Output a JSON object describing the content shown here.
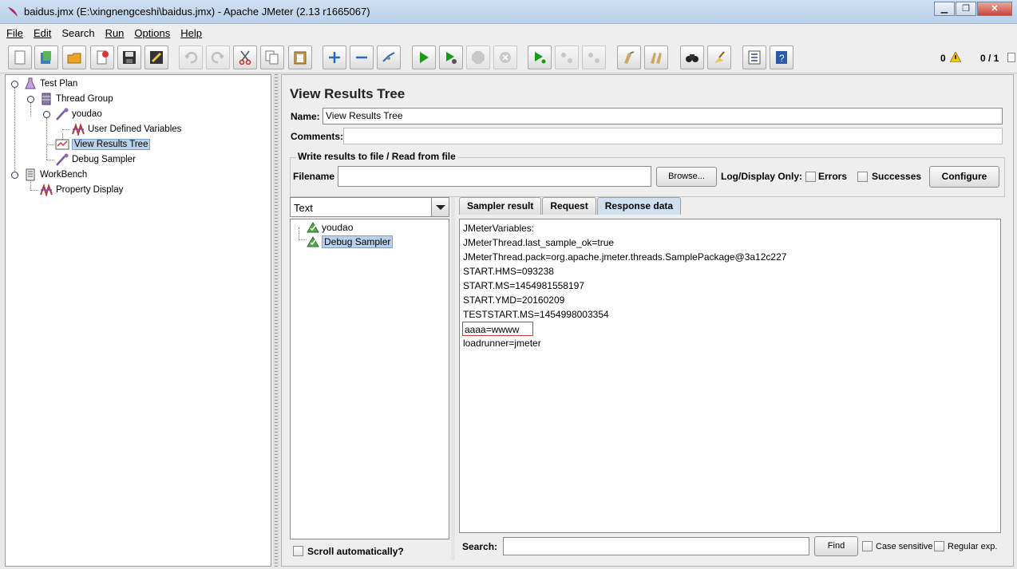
{
  "window": {
    "title": "baidus.jmx (E:\\xingnengceshi\\baidus.jmx) - Apache JMeter (2.13 r1665067)",
    "buttons": [
      "minimize",
      "restore",
      "close"
    ]
  },
  "menu": [
    "File",
    "Edit",
    "Search",
    "Run",
    "Options",
    "Help"
  ],
  "toolbar": {
    "buttons": [
      {
        "name": "new-icon"
      },
      {
        "name": "templates-icon"
      },
      {
        "name": "open-icon"
      },
      {
        "name": "close-file-icon"
      },
      {
        "name": "save-icon"
      },
      {
        "name": "save-screenshot-icon"
      },
      {
        "name": "undo-icon"
      },
      {
        "name": "redo-icon"
      },
      {
        "name": "cut-icon"
      },
      {
        "name": "copy-icon"
      },
      {
        "name": "paste-icon"
      },
      {
        "name": "expand-icon"
      },
      {
        "name": "collapse-icon"
      },
      {
        "name": "toggle-icon"
      },
      {
        "name": "start-icon"
      },
      {
        "name": "start-no-pauses-icon"
      },
      {
        "name": "stop-icon"
      },
      {
        "name": "shutdown-icon"
      },
      {
        "name": "remote-start-icon"
      },
      {
        "name": "remote-stop-icon"
      },
      {
        "name": "remote-shutdown-icon"
      },
      {
        "name": "clear-icon"
      },
      {
        "name": "clear-all-icon"
      },
      {
        "name": "search-icon"
      },
      {
        "name": "reset-search-icon"
      },
      {
        "name": "function-helper-icon"
      },
      {
        "name": "help-icon"
      }
    ],
    "warn_count": "0",
    "threads": "0 / 1"
  },
  "tree": [
    {
      "label": "Test Plan",
      "icon": "test-plan-icon"
    },
    {
      "label": "Thread Group",
      "icon": "thread-group-icon"
    },
    {
      "label": "youdao",
      "icon": "sampler-icon"
    },
    {
      "label": "User Defined Variables",
      "icon": "config-element-icon"
    },
    {
      "label": "View Results Tree",
      "icon": "listener-icon"
    },
    {
      "label": "Debug Sampler",
      "icon": "sampler-icon"
    },
    {
      "label": "WorkBench",
      "icon": "workbench-icon"
    },
    {
      "label": "Property Display",
      "icon": "config-element-icon"
    }
  ],
  "panel": {
    "title": "View Results Tree",
    "name_label": "Name:",
    "name_value": "View Results Tree",
    "comments_label": "Comments:",
    "file_group_title": "Write results to file / Read from file",
    "filename_label": "Filename",
    "filename_value": "",
    "browse_label": "Browse...",
    "log_display_label": "Log/Display Only:",
    "errors_label": "Errors",
    "successes_label": "Successes",
    "configure_label": "Configure"
  },
  "results": {
    "renderer": "Text",
    "items": [
      "youdao",
      "Debug Sampler"
    ],
    "scroll_auto_label": "Scroll automatically?",
    "tabs": [
      "Sampler result",
      "Request",
      "Response data"
    ],
    "active_tab": "Response data",
    "response_lines": [
      "JMeterVariables:",
      "JMeterThread.last_sample_ok=true",
      "JMeterThread.pack=org.apache.jmeter.threads.SamplePackage@3a12c227",
      "START.HMS=093238",
      "START.MS=1454981558197",
      "START.YMD=20160209",
      "TESTSTART.MS=1454998003354",
      "aaaa=wwww",
      "loadrunner=jmeter"
    ],
    "search_label": "Search:",
    "search_value": "",
    "find_label": "Find",
    "case_sensitive_label": "Case sensitive",
    "regular_exp_label": "Regular exp."
  },
  "colors": {
    "selection": "#b9d1ea",
    "highlight_border": "#d23a3a",
    "play_green": "#1a9a1a"
  }
}
